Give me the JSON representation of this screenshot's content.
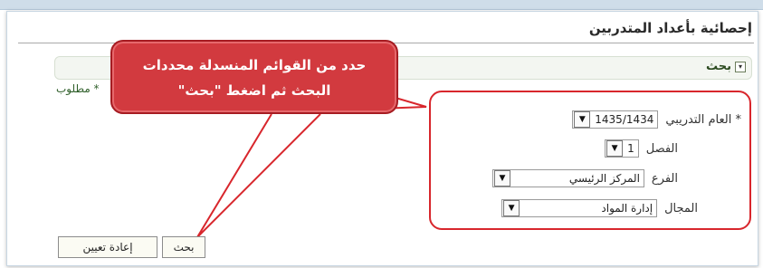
{
  "page": {
    "title": "إحصائية بأعداد المتدربين"
  },
  "section": {
    "label": "بحث",
    "icon": "collapse-toggle-icon"
  },
  "required_note": "* مطلوب",
  "fields": {
    "year": {
      "label": "* العام التدريبي",
      "value": "1435/1434"
    },
    "semester": {
      "label": "الفصل",
      "value": "1"
    },
    "branch": {
      "label": "الفرع",
      "value": "المركز الرئيسي"
    },
    "domain": {
      "label": "المجال",
      "value": "إدارة المواد"
    }
  },
  "callout": {
    "line1": "حدد من القوائم المنسدلة محددات",
    "line2": "البحث ثم اضغط \"بحث\""
  },
  "buttons": {
    "search": "بحث",
    "reset": "إعادة تعيين"
  },
  "colors": {
    "highlight": "#d8262c",
    "callout_fill": "#d23a3f"
  }
}
